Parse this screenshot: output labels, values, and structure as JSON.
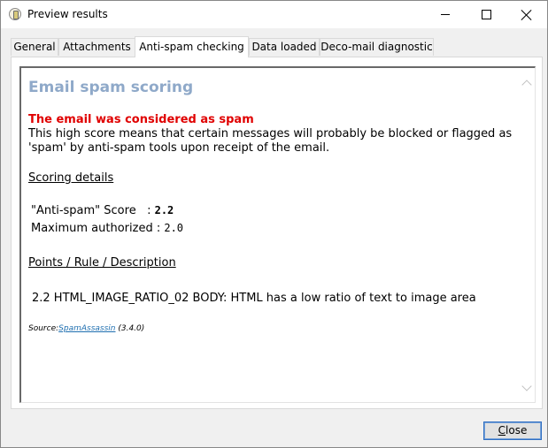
{
  "window": {
    "title": "Preview results"
  },
  "tabs": [
    {
      "label": "General"
    },
    {
      "label": "Attachments"
    },
    {
      "label": "Anti-spam checking",
      "active": true
    },
    {
      "label": "Data loaded"
    },
    {
      "label": "Deco-mail diagnostic"
    }
  ],
  "report": {
    "heading": "Email spam scoring",
    "alert": "The email was considered as spam",
    "description": "This high score means that certain messages will probably be blocked or flagged as 'spam' by anti-spam tools upon receipt of the email.",
    "scoring_details_title": "Scoring details",
    "score_label": "\"Anti-spam\" Score   : ",
    "score_value": "2.2",
    "max_label": "Maximum authorized : ",
    "max_value": "2.0",
    "points_title": "Points / Rule / Description",
    "rule_line": "2.2 HTML_IMAGE_RATIO_02 BODY: HTML has a low ratio of text to image area",
    "source_prefix": "Source:",
    "source_link": "SpamAssassin",
    "source_version": " (3.4.0)"
  },
  "footer": {
    "close_label_underlined": "C",
    "close_label_rest": "lose"
  },
  "colors": {
    "heading": "#8fa9c9",
    "alert": "#e00000",
    "link": "#1f6fb0"
  },
  "icons": {
    "app": "app-icon",
    "minimize": "minimize-icon",
    "maximize": "maximize-icon",
    "close": "close-icon",
    "scroll_up": "chevron-up-icon",
    "scroll_down": "chevron-down-icon"
  }
}
